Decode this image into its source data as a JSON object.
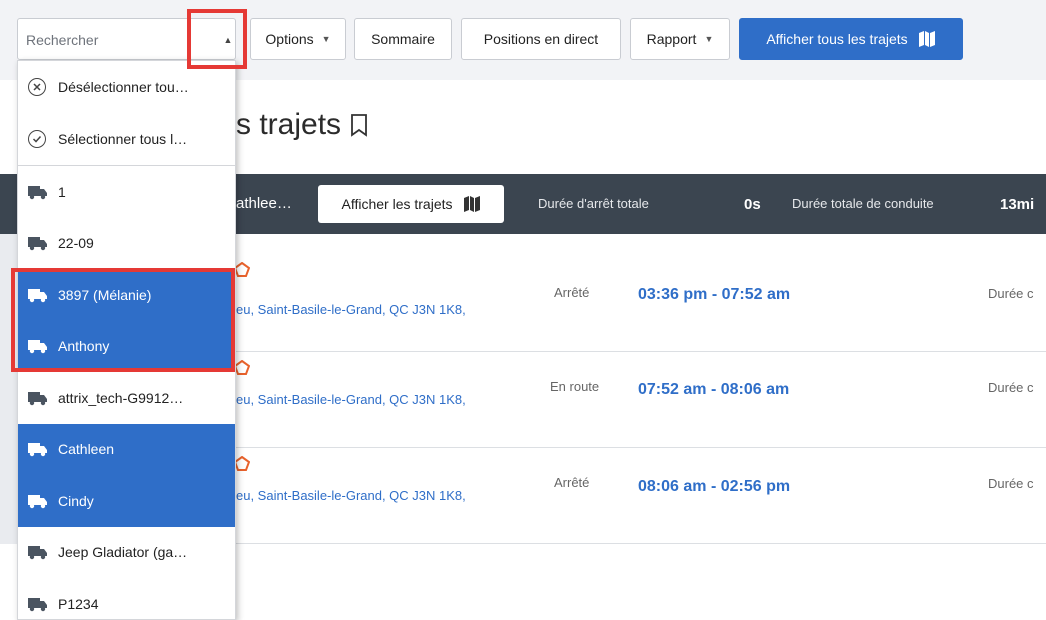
{
  "toolbar": {
    "search_placeholder": "Rechercher",
    "options_label": "Options",
    "summary_label": "Sommaire",
    "live_positions_label": "Positions en direct",
    "report_label": "Rapport",
    "show_all_trips_label": "Afficher tous les trajets"
  },
  "page": {
    "title": "s trajets"
  },
  "summary_bar": {
    "vehicle_name": "athlee…",
    "show_trips_label": "Afficher les trajets",
    "total_stop_label": "Durée d'arrêt totale",
    "total_stop_value": "0s",
    "total_drive_label": "Durée totale de conduite",
    "total_drive_value": "13mi"
  },
  "trips": [
    {
      "address": "eu, Saint-Basile-le-Grand, QC J3N 1K8,",
      "status": "Arrêté",
      "time": "03:36 pm - 07:52 am",
      "duration_label": "Durée c"
    },
    {
      "address": "eu, Saint-Basile-le-Grand, QC J3N 1K8,",
      "status": "En route",
      "time": "07:52 am - 08:06 am",
      "duration_label": "Durée c"
    },
    {
      "address": "eu, Saint-Basile-le-Grand, QC J3N 1K8,",
      "status": "Arrêté",
      "time": "08:06 am - 02:56 pm",
      "duration_label": "Durée c"
    }
  ],
  "dropdown": {
    "deselect_all": "Désélectionner tou…",
    "select_all": "Sélectionner tous l…",
    "items": [
      {
        "label": "1",
        "selected": false
      },
      {
        "label": "22-09",
        "selected": false
      },
      {
        "label": "3897 (Mélanie)",
        "selected": true
      },
      {
        "label": "Anthony",
        "selected": true
      },
      {
        "label": "attrix_tech-G9912…",
        "selected": false
      },
      {
        "label": "Cathleen",
        "selected": true
      },
      {
        "label": "Cindy",
        "selected": true
      },
      {
        "label": "Jeep Gladiator (ga…",
        "selected": false
      },
      {
        "label": "P1234",
        "selected": false
      }
    ]
  },
  "colors": {
    "accent": "#2f6ec8",
    "highlight": "#e53935",
    "dark_bar": "#3b4550"
  },
  "icons": {
    "deselect": "x-circle-icon",
    "select": "check-circle-icon",
    "vehicle": "truck-icon",
    "map": "map-icon",
    "bookmark": "bookmark-icon",
    "location": "location-marker-icon"
  }
}
